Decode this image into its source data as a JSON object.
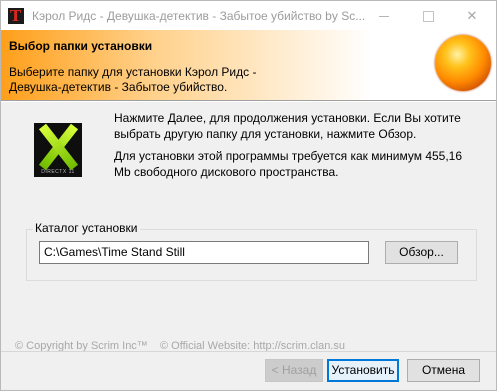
{
  "window": {
    "title": "Кэрол Ридс - Девушка-детектив - Забытое убийство by Sc...",
    "app_icon_letter": "T",
    "minimize_icon": "minimize-icon",
    "maximize_icon": "maximize-icon",
    "close_glyph": "✕"
  },
  "header": {
    "title": "Выбор папки установки",
    "subtitle": "Выберите папку для установки Кэрол Ридс - Девушка-детектив - Забытое убийство."
  },
  "body": {
    "logo_label": "DIRECTX 11",
    "instructions": "Нажмите Далее, для продолжения установки. Если Вы хотите выбрать другую папку для установки, нажмите Обзор.",
    "space_required": "Для установки этой программы требуется как минимум 455,16 Мb свободного дискового пространства."
  },
  "install_dir": {
    "group_label": "Каталог установки",
    "value": "C:\\Games\\Time Stand Still",
    "browse_label": "Обзор..."
  },
  "footer": {
    "copyright": "© Copyright by Scrim Inc™",
    "website": "© Official Website:   http://scrim.clan.su"
  },
  "buttons": {
    "back": "< Назад",
    "next": "Установить",
    "cancel": "Отмена"
  }
}
